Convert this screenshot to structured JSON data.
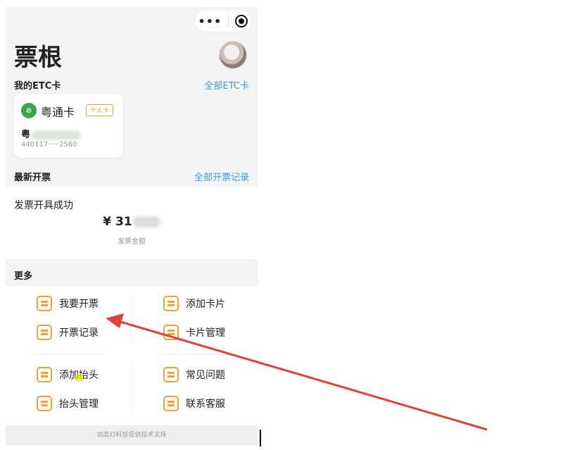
{
  "header": {
    "title": "票根",
    "capsule": {
      "menu_icon": "more-dots-icon",
      "close_icon": "target-icon"
    }
  },
  "etc": {
    "section_title": "我的ETC卡",
    "all_link": "全部ETC卡",
    "card": {
      "name": "粤通卡",
      "tag": "个人卡",
      "plate_prefix": "粤",
      "number": "440117·····2560",
      "logo_color": "#3aa54b"
    }
  },
  "latest": {
    "section_title": "最新开票",
    "all_link": "全部开票记录",
    "status": "发票开具成功",
    "amount": "¥ 31",
    "amount_label": "发票金额"
  },
  "more": {
    "section_title": "更多",
    "items": [
      {
        "label": "我要开票",
        "icon": "invoice-icon"
      },
      {
        "label": "添加卡片",
        "icon": "add-card-icon"
      },
      {
        "label": "开票记录",
        "icon": "record-icon"
      },
      {
        "label": "卡片管理",
        "icon": "card-manage-icon"
      },
      {
        "label": "添加抬头",
        "icon": "add-header-icon"
      },
      {
        "label": "常见问题",
        "icon": "question-icon"
      },
      {
        "label": "抬头管理",
        "icon": "header-manage-icon"
      },
      {
        "label": "联系客服",
        "icon": "service-icon"
      }
    ]
  },
  "footer": {
    "text": "由高灯科技提供技术支持"
  },
  "colors": {
    "accent": "#3a9be8",
    "icon": "#f0a13a",
    "arrow": "#e0413b"
  }
}
